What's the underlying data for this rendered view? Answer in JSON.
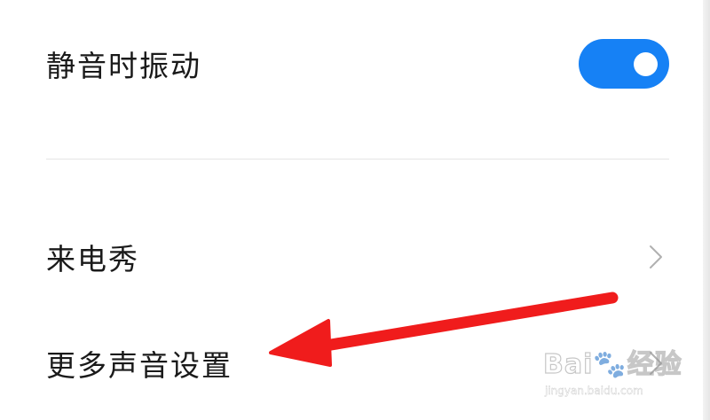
{
  "settings": {
    "vibrate_on_silent": {
      "label": "静音时振动",
      "enabled": true
    },
    "ringtone_show": {
      "label": "来电秀"
    },
    "more_sound_settings": {
      "label": "更多声音设置"
    }
  },
  "colors": {
    "toggle_on": "#1681f5",
    "annotation_arrow": "#f01c1c",
    "divider": "#e5e5e5",
    "text": "#1a1a1a",
    "chevron": "#b0b0b0"
  },
  "icons": {
    "row_chevron": "chevron-right-icon",
    "annotation": "red-arrow-annotation"
  },
  "watermark": {
    "brand": "Bai🐾经验",
    "url": "jingyan.baidu.com"
  }
}
